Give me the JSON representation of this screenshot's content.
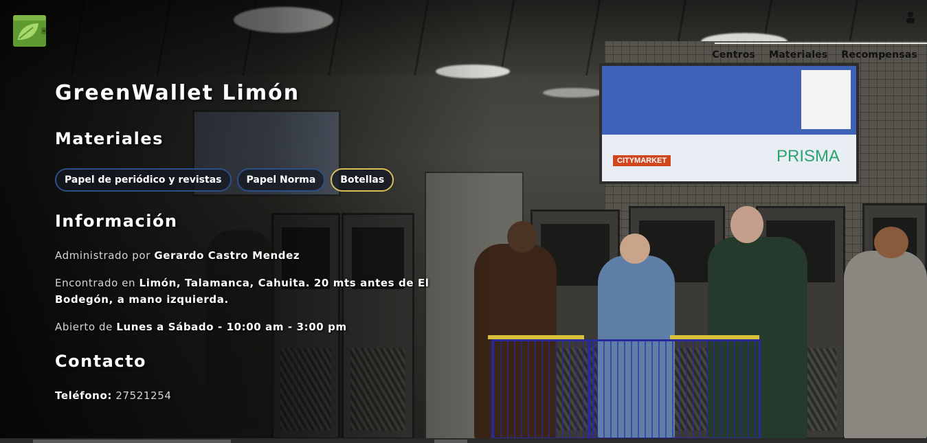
{
  "brand": {
    "logo_icon": "wallet-leaf-icon",
    "colors": {
      "logo_green": "#6ea83a",
      "chip_border_blue": "#2c4f86",
      "chip_border_gold": "#d9be5a"
    }
  },
  "nav": {
    "items": [
      {
        "label": "Centros"
      },
      {
        "label": "Materiales"
      },
      {
        "label": "Recompensas"
      }
    ],
    "user_icon": "user-icon"
  },
  "center": {
    "title": "GreenWallet Limón",
    "materials_heading": "Materiales",
    "materials": [
      {
        "label": "Papel de periódico y revistas"
      },
      {
        "label": "Papel Norma"
      },
      {
        "label": "Botellas"
      }
    ],
    "info_heading": "Información",
    "admin_prefix": "Administrado por",
    "admin_name": "Gerardo Castro Mendez",
    "location_prefix": "Encontrado en",
    "location_value": "Limón, Talamanca, Cahuita. 20 mts antes de El Bodegón, a mano izquierda.",
    "hours_prefix": "Abierto de",
    "hours_value": "Lunes a Sábado - 10:00 am - 3:00 pm",
    "contact_heading": "Contacto",
    "phone_label": "Teléfono:",
    "phone_value": "27521254"
  },
  "background": {
    "sign_brand_1": "CITYMARKET",
    "sign_brand_2": "PRISMA"
  }
}
